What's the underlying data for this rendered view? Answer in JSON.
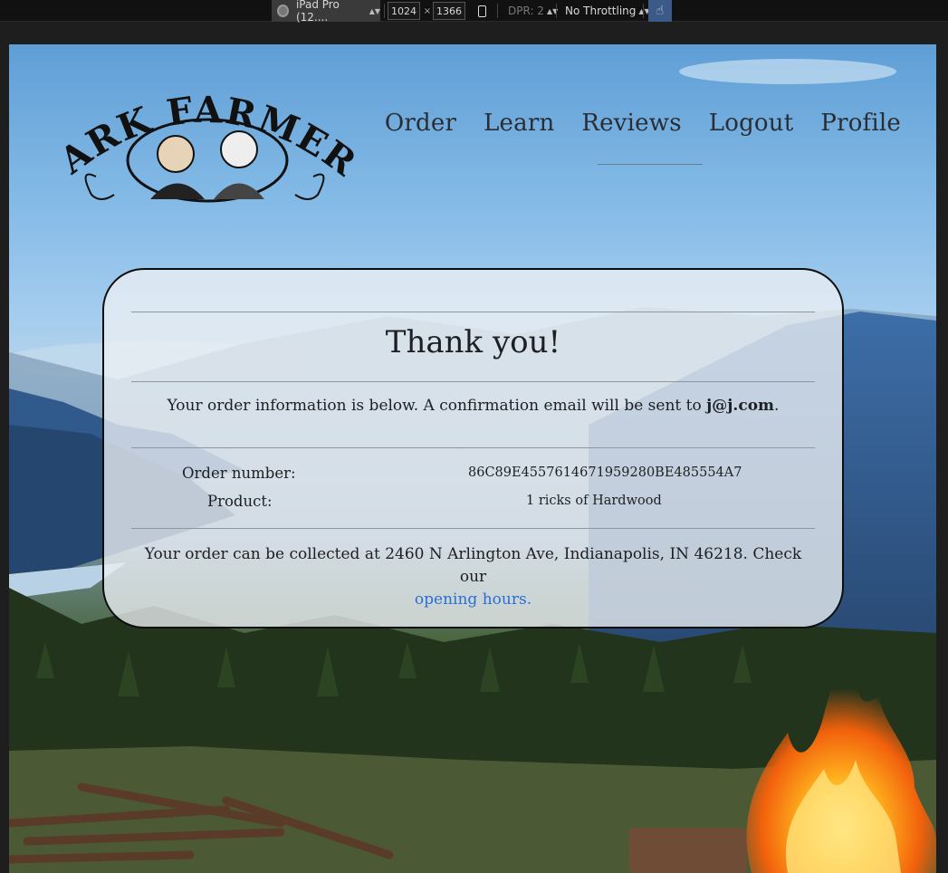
{
  "devtools": {
    "device": "iPad Pro (12....",
    "width": "1024",
    "times": "×",
    "height": "1366",
    "dpr": "DPR: 2",
    "throttling": "No Throttling"
  },
  "logo": {
    "text": "BARK FARMERS"
  },
  "nav": {
    "items": [
      "Order",
      "Learn",
      "Reviews",
      "Logout",
      "Profile"
    ],
    "active_index": 2
  },
  "confirmation": {
    "title": "Thank you!",
    "info_prefix": "Your order information is below. A confirmation email will be sent to ",
    "email": "j@j.com",
    "info_suffix": ".",
    "order_number_label": "Order number:",
    "order_number": "86C89E4557614671959280BE485554A7",
    "product_label": "Product:",
    "product": "1 ricks of Hardwood",
    "pickup_text": "Your order can be collected at 2460 N Arlington Ave, Indianapolis, IN 46218. Check our",
    "pickup_link": "opening hours."
  },
  "colors": {
    "link": "#2a6fd6",
    "card_border": "#0d0d0d",
    "devtools_bg": "#111111"
  }
}
